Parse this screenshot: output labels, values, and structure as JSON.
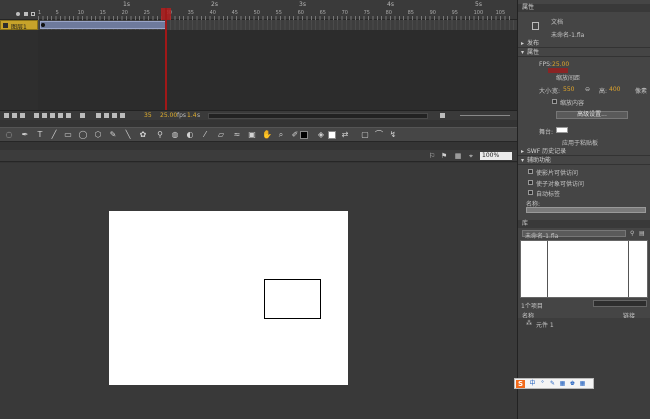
{
  "timeline": {
    "ruler": {
      "seconds": [
        "1s",
        "2s",
        "3s",
        "4s",
        "5s"
      ],
      "frames": [
        "1",
        "5",
        "10",
        "15",
        "20",
        "25",
        "30",
        "35",
        "40",
        "45",
        "50",
        "55",
        "60",
        "65",
        "70",
        "75",
        "80",
        "85",
        "90",
        "95",
        "100",
        "105",
        "110",
        "115",
        "120",
        "125",
        "130",
        "135"
      ]
    },
    "layer": {
      "name": "图层1"
    },
    "footer": {
      "current_frame": "35",
      "fps": "25.00",
      "fps_unit": "fps",
      "time": "1.4",
      "time_unit": "s"
    }
  },
  "stage": {
    "zoom": "100%"
  },
  "properties": {
    "tab_title": "属性",
    "doc_type": "文档",
    "doc_name": "未命名-1.fla",
    "sections": {
      "publish": "发布",
      "props": "属性",
      "swf_history": "SWF 历史记录",
      "aux": "辅助功能"
    },
    "fps_label": "FPS:",
    "fps_value": "25.00",
    "scale_span": "缩放间距",
    "size_label": "大小:",
    "width_label": "宽:",
    "width_value": "550",
    "height_label": "高:",
    "height_value": "400",
    "size_unit": "像素",
    "scale_content": "缩放内容",
    "advanced_btn": "高级设置...",
    "stage_label": "舞台:",
    "apply_pasteboard": "应用于粘贴板",
    "aux_items": [
      "使影片可供访问",
      "使子对象可供访问",
      "自动标签"
    ],
    "name_label": "名称:"
  },
  "library": {
    "tab_title": "库",
    "doc_select": "未命名-1.fla",
    "item_count": "1个项目",
    "col_name": "名称",
    "col_link": "链接",
    "items": [
      "元件 1"
    ]
  },
  "ime": {
    "logo": "S",
    "items": [
      "中",
      "°",
      "✎",
      "▦",
      "♚",
      "▦"
    ]
  }
}
